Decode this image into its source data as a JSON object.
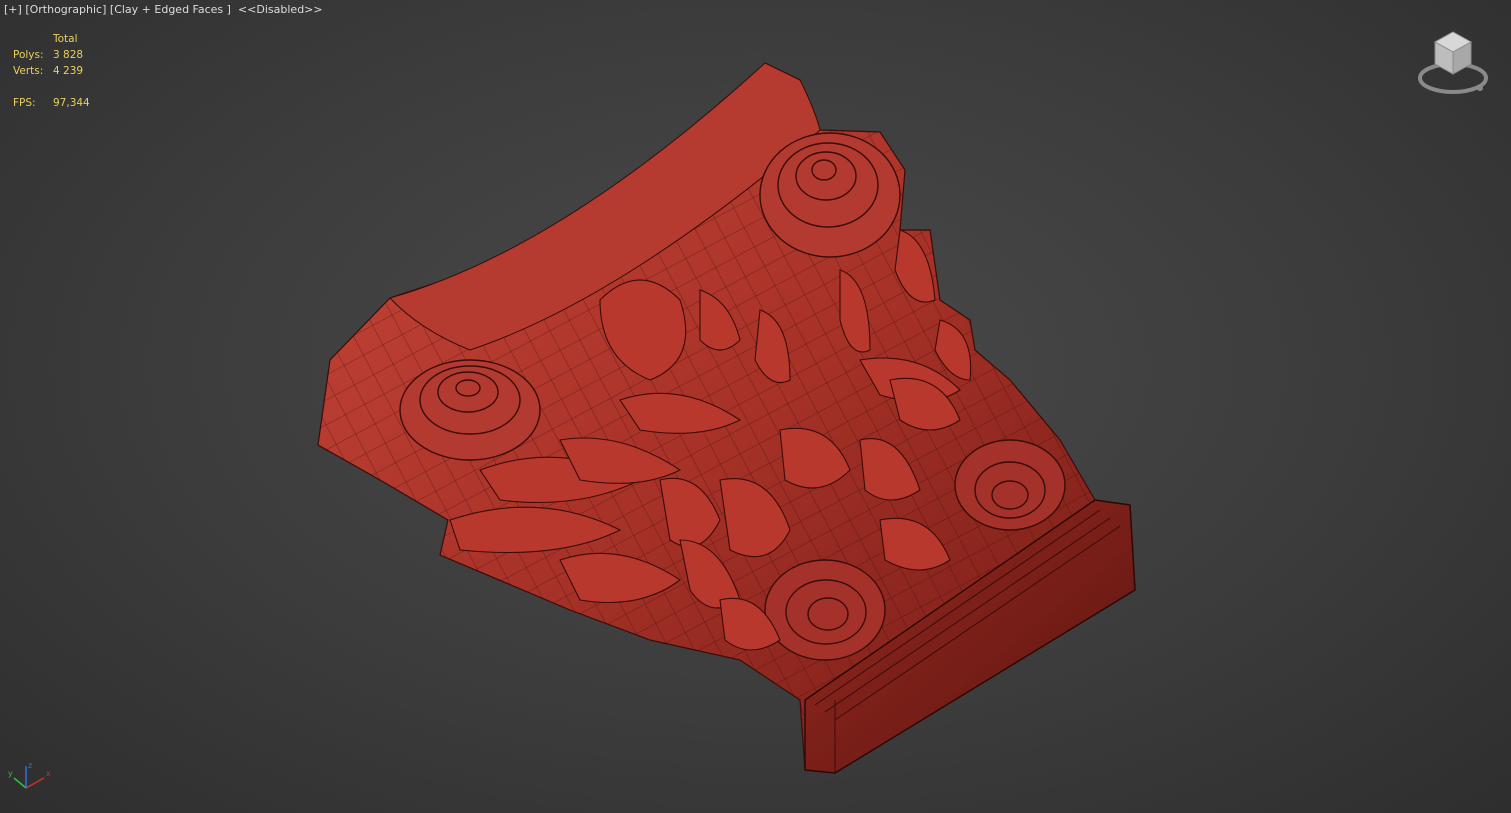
{
  "viewport": {
    "menu_plus": "[+]",
    "view": "[Orthographic]",
    "shading": "[Clay + Edged Faces ]",
    "disabled": "<<Disabled>>"
  },
  "stats": {
    "header": "Total",
    "polys_label": "Polys:",
    "polys_value": "3 828",
    "verts_label": "Verts:",
    "verts_value": "4 239",
    "fps_label": "FPS:",
    "fps_value": "97,344"
  },
  "viewcube": {
    "icon": "viewcube-icon"
  },
  "axis": {
    "x": "x",
    "y": "y",
    "z": "z"
  },
  "colors": {
    "background": "#3c3c3c",
    "model": "#b8392f",
    "stats_text": "#e8d060",
    "label_text": "#dcdcdc"
  }
}
